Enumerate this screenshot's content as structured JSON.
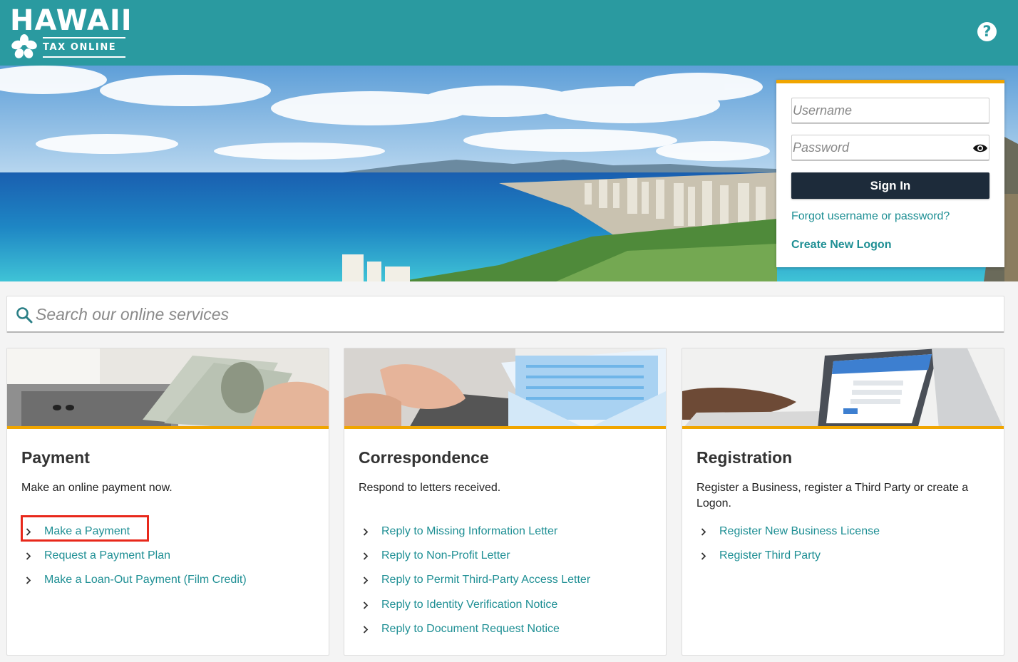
{
  "header": {
    "logo_title": "HAWAII",
    "logo_subtitle": "TAX ONLINE",
    "help_label": "?"
  },
  "login": {
    "username_placeholder": "Username",
    "password_placeholder": "Password",
    "signin_label": "Sign In",
    "forgot_label": "Forgot username or password?",
    "create_label": "Create New Logon"
  },
  "search": {
    "placeholder": "Search our online services"
  },
  "cards": [
    {
      "title": "Payment",
      "description": "Make an online payment now.",
      "links": [
        "Make a Payment",
        "Request a Payment Plan",
        "Make a Loan-Out Payment (Film Credit)"
      ]
    },
    {
      "title": "Correspondence",
      "description": "Respond to letters received.",
      "links": [
        "Reply to Missing Information Letter",
        "Reply to Non-Profit Letter",
        "Reply to Permit Third-Party Access Letter",
        "Reply to Identity Verification Notice",
        "Reply to Document Request Notice"
      ]
    },
    {
      "title": "Registration",
      "description": "Register a Business, register a Third Party or create a Logon.",
      "links": [
        "Register New Business License",
        "Register Third Party"
      ]
    }
  ],
  "colors": {
    "header_bg": "#2a9aa0",
    "accent_gold": "#f0a500",
    "link_teal": "#1e8f94",
    "signin_bg": "#1d2b3a",
    "highlight_red": "#e8281b"
  },
  "icons": {
    "help": "question-circle-icon",
    "eye": "eye-icon",
    "search": "search-icon",
    "chevron": "chevron-right-icon",
    "logo": "hibiscus-icon"
  }
}
